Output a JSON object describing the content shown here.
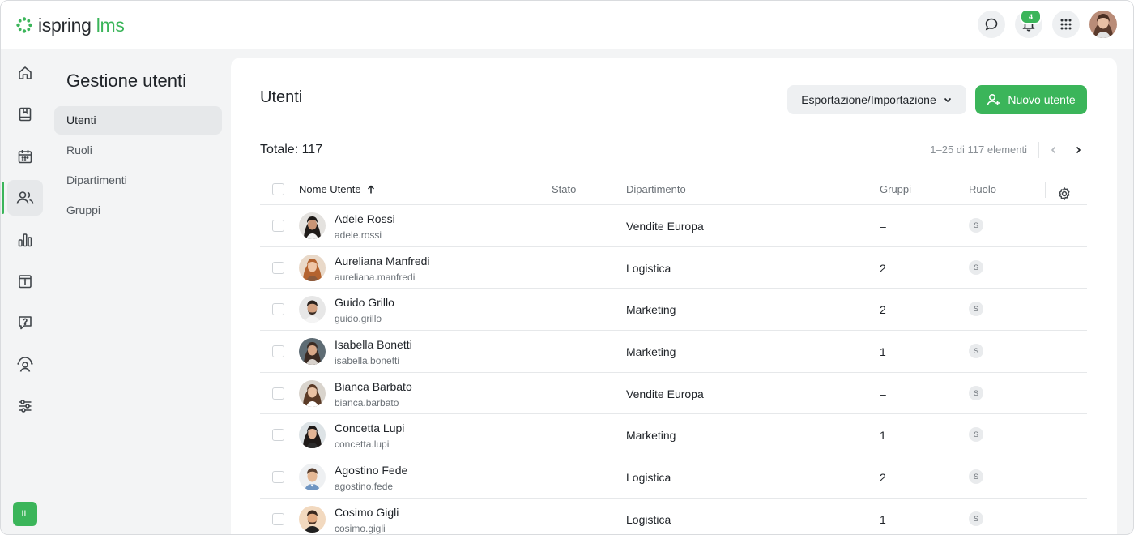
{
  "brand": {
    "name": "ispring",
    "suffix": "lms",
    "accent": "#3bb55a"
  },
  "topbar": {
    "notifications_count": "4"
  },
  "rail": {
    "items": [
      {
        "icon": "home-icon"
      },
      {
        "icon": "book-icon"
      },
      {
        "icon": "calendar-icon"
      },
      {
        "icon": "users-icon",
        "active": true
      },
      {
        "icon": "chart-icon"
      },
      {
        "icon": "info-card-icon"
      },
      {
        "icon": "question-chat-icon"
      },
      {
        "icon": "user-settings-icon"
      },
      {
        "icon": "sliders-icon"
      }
    ],
    "user_initials": "IL"
  },
  "subnav": {
    "title": "Gestione utenti",
    "items": [
      {
        "label": "Utenti",
        "active": true
      },
      {
        "label": "Ruoli"
      },
      {
        "label": "Dipartimenti"
      },
      {
        "label": "Gruppi"
      }
    ]
  },
  "main": {
    "title": "Utenti",
    "export_label": "Esportazione/Importazione",
    "new_user_label": "Nuovo utente",
    "total_label": "Totale: 117",
    "pagination": "1–25 di 117 elementi",
    "columns": {
      "name": "Nome Utente",
      "status": "Stato",
      "department": "Dipartimento",
      "groups": "Gruppi",
      "role": "Ruolo"
    },
    "rows": [
      {
        "name": "Adele Rossi",
        "login": "adele.rossi",
        "department": "Vendite Europa",
        "groups": "–",
        "role": "S"
      },
      {
        "name": "Aureliana Manfredi",
        "login": "aureliana.manfredi",
        "department": "Logistica",
        "groups": "2",
        "role": "S"
      },
      {
        "name": "Guido Grillo",
        "login": "guido.grillo",
        "department": "Marketing",
        "groups": "2",
        "role": "S"
      },
      {
        "name": "Isabella Bonetti",
        "login": "isabella.bonetti",
        "department": "Marketing",
        "groups": "1",
        "role": "S"
      },
      {
        "name": "Bianca Barbato",
        "login": "bianca.barbato",
        "department": "Vendite Europa",
        "groups": "–",
        "role": "S"
      },
      {
        "name": "Concetta Lupi",
        "login": "concetta.lupi",
        "department": "Marketing",
        "groups": "1",
        "role": "S"
      },
      {
        "name": "Agostino Fede",
        "login": "agostino.fede",
        "department": "Logistica",
        "groups": "2",
        "role": "S"
      },
      {
        "name": "Cosimo Gigli",
        "login": "cosimo.gigli",
        "department": "Logistica",
        "groups": "1",
        "role": "S"
      }
    ]
  }
}
